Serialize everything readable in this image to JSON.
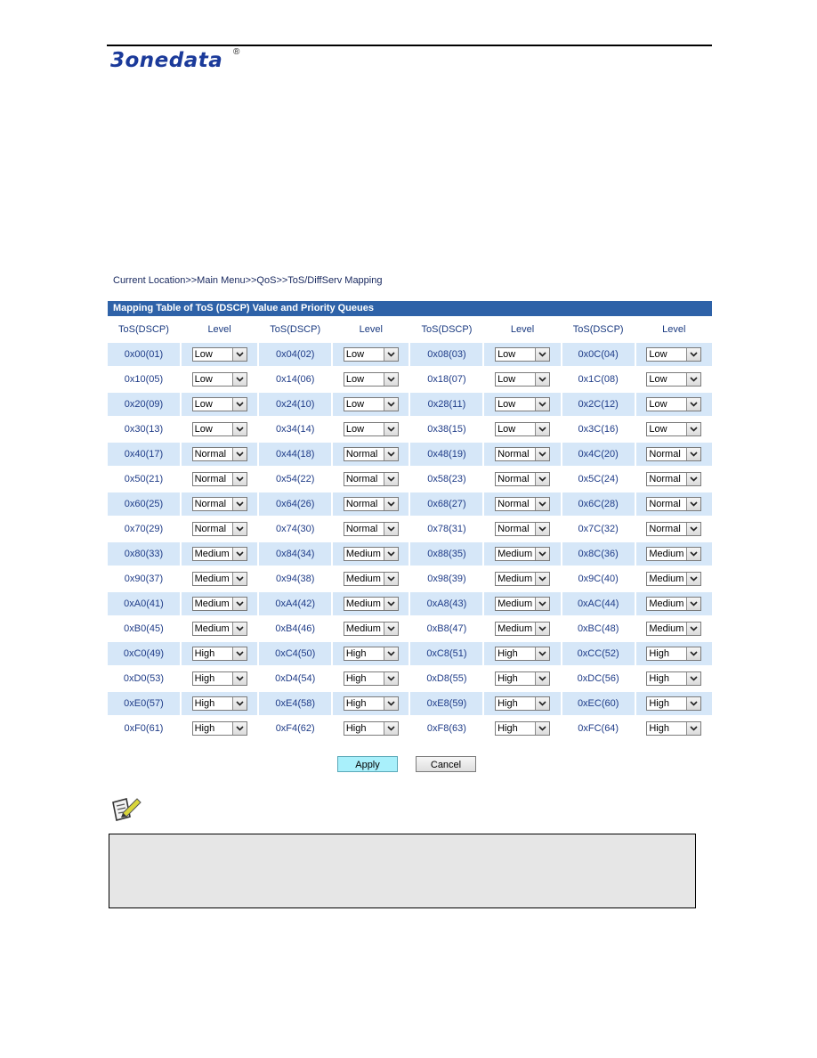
{
  "header": {
    "logo_text": "3onedata",
    "logo_mark": "®"
  },
  "breadcrumb": "Current Location>>Main Menu>>QoS>>ToS/DiffServ Mapping",
  "panel": {
    "title": "Mapping Table of ToS (DSCP) Value and Priority Queues",
    "headers": [
      "ToS(DSCP)",
      "Level",
      "ToS(DSCP)",
      "Level",
      "ToS(DSCP)",
      "Level",
      "ToS(DSCP)",
      "Level"
    ],
    "rows": [
      [
        {
          "tos": "0x00(01)",
          "level": "Low"
        },
        {
          "tos": "0x04(02)",
          "level": "Low"
        },
        {
          "tos": "0x08(03)",
          "level": "Low"
        },
        {
          "tos": "0x0C(04)",
          "level": "Low"
        }
      ],
      [
        {
          "tos": "0x10(05)",
          "level": "Low"
        },
        {
          "tos": "0x14(06)",
          "level": "Low"
        },
        {
          "tos": "0x18(07)",
          "level": "Low"
        },
        {
          "tos": "0x1C(08)",
          "level": "Low"
        }
      ],
      [
        {
          "tos": "0x20(09)",
          "level": "Low"
        },
        {
          "tos": "0x24(10)",
          "level": "Low"
        },
        {
          "tos": "0x28(11)",
          "level": "Low"
        },
        {
          "tos": "0x2C(12)",
          "level": "Low"
        }
      ],
      [
        {
          "tos": "0x30(13)",
          "level": "Low"
        },
        {
          "tos": "0x34(14)",
          "level": "Low"
        },
        {
          "tos": "0x38(15)",
          "level": "Low"
        },
        {
          "tos": "0x3C(16)",
          "level": "Low"
        }
      ],
      [
        {
          "tos": "0x40(17)",
          "level": "Normal"
        },
        {
          "tos": "0x44(18)",
          "level": "Normal"
        },
        {
          "tos": "0x48(19)",
          "level": "Normal"
        },
        {
          "tos": "0x4C(20)",
          "level": "Normal"
        }
      ],
      [
        {
          "tos": "0x50(21)",
          "level": "Normal"
        },
        {
          "tos": "0x54(22)",
          "level": "Normal"
        },
        {
          "tos": "0x58(23)",
          "level": "Normal"
        },
        {
          "tos": "0x5C(24)",
          "level": "Normal"
        }
      ],
      [
        {
          "tos": "0x60(25)",
          "level": "Normal"
        },
        {
          "tos": "0x64(26)",
          "level": "Normal"
        },
        {
          "tos": "0x68(27)",
          "level": "Normal"
        },
        {
          "tos": "0x6C(28)",
          "level": "Normal"
        }
      ],
      [
        {
          "tos": "0x70(29)",
          "level": "Normal"
        },
        {
          "tos": "0x74(30)",
          "level": "Normal"
        },
        {
          "tos": "0x78(31)",
          "level": "Normal"
        },
        {
          "tos": "0x7C(32)",
          "level": "Normal"
        }
      ],
      [
        {
          "tos": "0x80(33)",
          "level": "Medium"
        },
        {
          "tos": "0x84(34)",
          "level": "Medium"
        },
        {
          "tos": "0x88(35)",
          "level": "Medium"
        },
        {
          "tos": "0x8C(36)",
          "level": "Medium"
        }
      ],
      [
        {
          "tos": "0x90(37)",
          "level": "Medium"
        },
        {
          "tos": "0x94(38)",
          "level": "Medium"
        },
        {
          "tos": "0x98(39)",
          "level": "Medium"
        },
        {
          "tos": "0x9C(40)",
          "level": "Medium"
        }
      ],
      [
        {
          "tos": "0xA0(41)",
          "level": "Medium"
        },
        {
          "tos": "0xA4(42)",
          "level": "Medium"
        },
        {
          "tos": "0xA8(43)",
          "level": "Medium"
        },
        {
          "tos": "0xAC(44)",
          "level": "Medium"
        }
      ],
      [
        {
          "tos": "0xB0(45)",
          "level": "Medium"
        },
        {
          "tos": "0xB4(46)",
          "level": "Medium"
        },
        {
          "tos": "0xB8(47)",
          "level": "Medium"
        },
        {
          "tos": "0xBC(48)",
          "level": "Medium"
        }
      ],
      [
        {
          "tos": "0xC0(49)",
          "level": "High"
        },
        {
          "tos": "0xC4(50)",
          "level": "High"
        },
        {
          "tos": "0xC8(51)",
          "level": "High"
        },
        {
          "tos": "0xCC(52)",
          "level": "High"
        }
      ],
      [
        {
          "tos": "0xD0(53)",
          "level": "High"
        },
        {
          "tos": "0xD4(54)",
          "level": "High"
        },
        {
          "tos": "0xD8(55)",
          "level": "High"
        },
        {
          "tos": "0xDC(56)",
          "level": "High"
        }
      ],
      [
        {
          "tos": "0xE0(57)",
          "level": "High"
        },
        {
          "tos": "0xE4(58)",
          "level": "High"
        },
        {
          "tos": "0xE8(59)",
          "level": "High"
        },
        {
          "tos": "0xEC(60)",
          "level": "High"
        }
      ],
      [
        {
          "tos": "0xF0(61)",
          "level": "High"
        },
        {
          "tos": "0xF4(62)",
          "level": "High"
        },
        {
          "tos": "0xF8(63)",
          "level": "High"
        },
        {
          "tos": "0xFC(64)",
          "level": "High"
        }
      ]
    ]
  },
  "buttons": {
    "apply": "Apply",
    "cancel": "Cancel"
  },
  "note": {
    "icon": "note-pencil-icon",
    "text": ""
  },
  "colors": {
    "title_bar": "#2e62a8",
    "row_shade": "#d6e7f8",
    "apply_button": "#a9f0fb",
    "note_box": "#e6e6e6",
    "logo": "#1b3a9a"
  }
}
